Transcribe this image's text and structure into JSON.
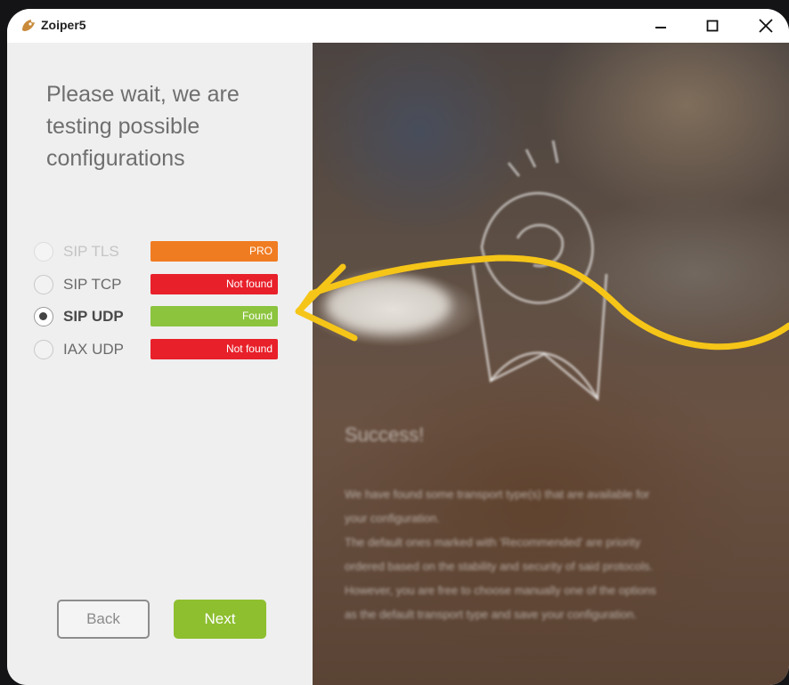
{
  "window": {
    "title": "Zoiper5"
  },
  "heading": {
    "line1": "Please wait, we are",
    "line2": "testing possible",
    "line3": "configurations"
  },
  "transports": [
    {
      "label": "SIP TLS",
      "status": "PRO",
      "status_color": "#f07c22",
      "state": "disabled"
    },
    {
      "label": "SIP TCP",
      "status": "Not found",
      "status_color": "#e8202a",
      "state": "unchecked"
    },
    {
      "label": "SIP UDP",
      "status": "Found",
      "status_color": "#8cc43e",
      "state": "checked"
    },
    {
      "label": "IAX UDP",
      "status": "Not found",
      "status_color": "#e8202a",
      "state": "unchecked"
    }
  ],
  "buttons": {
    "back": "Back",
    "next": "Next"
  },
  "info_panel": {
    "title": "Success!",
    "body_line1": "We have found some transport type(s) that are available for",
    "body_line2": "your configuration.",
    "body_line3": "The default ones marked with 'Recommended' are priority",
    "body_line4": "ordered based on the stability and security of said protocols.",
    "body_line5": "However, you are free to choose manually one of the options",
    "body_line6": "as the default transport type and save your configuration."
  },
  "icons": [
    "app-logo-icon",
    "minimize-icon",
    "maximize-icon",
    "close-icon",
    "arrow-annotation-icon"
  ],
  "colors": {
    "accent_green": "#8dbf2f",
    "annotation_yellow": "#f5c518"
  }
}
